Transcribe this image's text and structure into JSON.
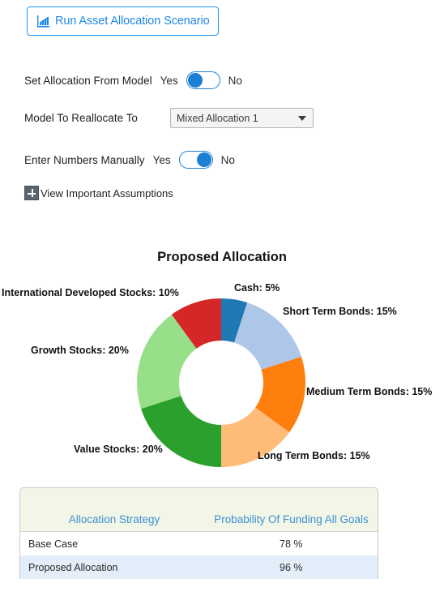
{
  "run_button": {
    "label": "Run Asset Allocation Scenario",
    "icon": "bar-chart-icon",
    "accent_color": "#1e88e5"
  },
  "form": {
    "set_allocation": {
      "label": "Set Allocation From Model",
      "yes_label": "Yes",
      "no_label": "No",
      "state": "Yes"
    },
    "model_to_reallocate": {
      "label": "Model To Reallocate To",
      "value": "Mixed Allocation 1",
      "caret_icon": "chevron-down-icon"
    },
    "enter_manually": {
      "label": "Enter Numbers Manually",
      "yes_label": "Yes",
      "no_label": "No",
      "state": "No"
    },
    "assumptions": {
      "label": "View Important Assumptions",
      "icon": "plus-box-icon"
    }
  },
  "chart_data": {
    "type": "pie",
    "title": "Proposed Allocation",
    "donut": true,
    "inner_radius_ratio": 0.5,
    "start_angle_deg": 0,
    "direction": "clockwise",
    "categories": [
      "Cash",
      "Short Term Bonds",
      "Medium Term Bonds",
      "Long Term Bonds",
      "Value Stocks",
      "Growth Stocks",
      "International Developed Stocks"
    ],
    "values": [
      5,
      15,
      15,
      15,
      20,
      20,
      10
    ],
    "unit": "%",
    "colors": [
      "#1f78b4",
      "#aec7e8",
      "#ff7f0e",
      "#ffbb78",
      "#2ca02c",
      "#98df8a",
      "#d62728"
    ],
    "labels": [
      "Cash: 5%",
      "Short Term Bonds: 15%",
      "Medium Term Bonds: 15%",
      "Long Term Bonds: 15%",
      "Value Stocks: 20%",
      "Growth Stocks: 20%",
      "International Developed Stocks: 10%"
    ],
    "legend": "outside-labels",
    "xlabel": "",
    "ylabel": ""
  },
  "table": {
    "columns": [
      "Allocation Strategy",
      "Probability Of Funding All Goals"
    ],
    "rows": [
      {
        "strategy": "Base Case",
        "probability": "78 %"
      },
      {
        "strategy": "Proposed Allocation",
        "probability": "96 %"
      }
    ],
    "header_bg": "#f2f6e7",
    "header_text_color": "#3b8fd4",
    "alt_row_bg": "#e4eefb"
  }
}
